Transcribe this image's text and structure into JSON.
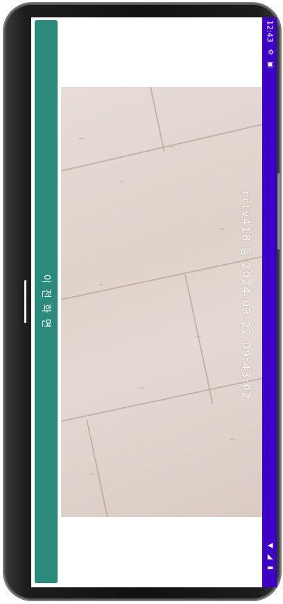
{
  "status_bar": {
    "time": "12:43",
    "icons": [
      "gear-icon",
      "sim-icon",
      "wifi-icon",
      "signal-icon",
      "battery-icon"
    ]
  },
  "back_button": {
    "label": "이 전 화 면"
  },
  "camera_preview": {
    "overlay_text": "cctv418 등 2024-03-22 09:43:02"
  },
  "colors": {
    "back_button": "#2b8a7c",
    "status_bar": "#3d00c4",
    "screen": "#ffffff"
  }
}
